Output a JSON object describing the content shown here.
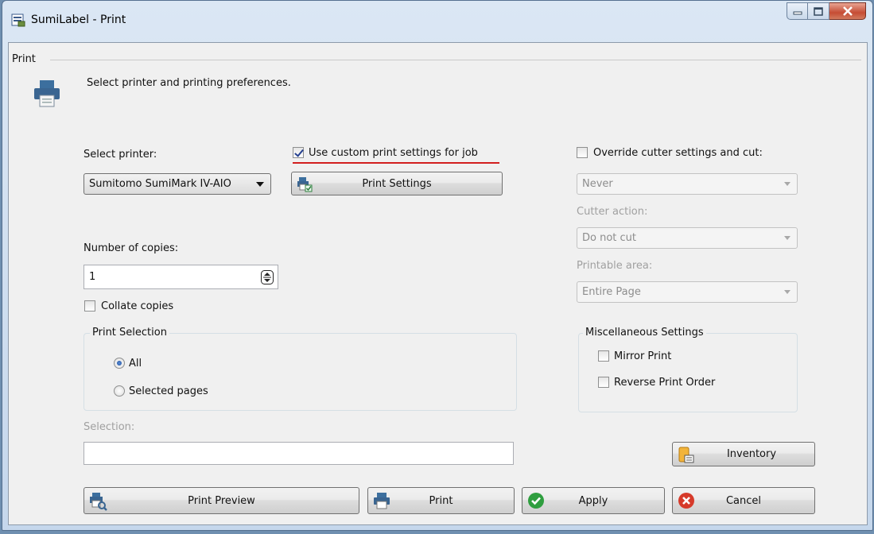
{
  "window": {
    "title": "SumiLabel - Print"
  },
  "header": {
    "section_title": "Print",
    "description": "Select printer and printing preferences."
  },
  "printer": {
    "label": "Select printer:",
    "selected": "Sumitomo SumiMark IV-AIO"
  },
  "custom_settings": {
    "label": "Use custom print settings for job",
    "checked": true,
    "button_label": "Print Settings"
  },
  "copies": {
    "label": "Number of copies:",
    "value": "1",
    "collate_label": "Collate copies",
    "collate_checked": false
  },
  "print_selection": {
    "title": "Print Selection",
    "options": [
      {
        "label": "All",
        "checked": true
      },
      {
        "label": "Selected pages",
        "checked": false
      }
    ]
  },
  "selection": {
    "label": "Selection:",
    "value": ""
  },
  "cutter": {
    "override_label": "Override cutter settings and cut:",
    "override_checked": false,
    "cut_value": "Never",
    "action_label": "Cutter action:",
    "action_value": "Do not cut",
    "area_label": "Printable area:",
    "area_value": "Entire Page"
  },
  "misc": {
    "title": "Miscellaneous Settings",
    "mirror_label": "Mirror Print",
    "reverse_label": "Reverse Print Order"
  },
  "buttons": {
    "inventory": "Inventory",
    "preview": "Print Preview",
    "print": "Print",
    "apply": "Apply",
    "cancel": "Cancel"
  },
  "colors": {
    "accent_underline": "#d21f1f",
    "apply_green": "#2f9e3f",
    "cancel_red": "#d63a2a"
  }
}
